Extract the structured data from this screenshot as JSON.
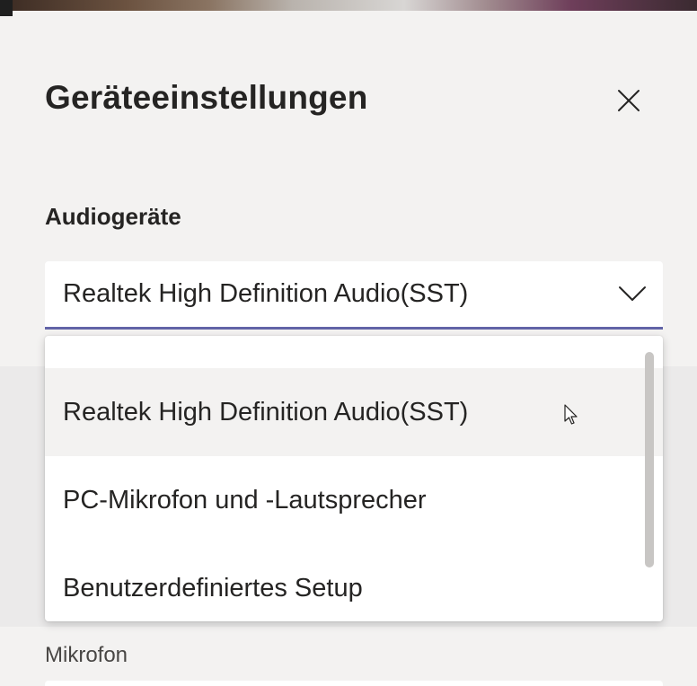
{
  "dialog": {
    "title": "Geräteeinstellungen",
    "close_icon": "close-icon"
  },
  "audio": {
    "label": "Audiogeräte",
    "selected": "Realtek High Definition Audio(SST)",
    "chevron_icon": "chevron-down-icon",
    "accent_color": "#6264a7",
    "options": [
      {
        "label": "Realtek High Definition Audio(SST)",
        "hovered": true
      },
      {
        "label": "PC-Mikrofon und -Lautsprecher",
        "hovered": false
      },
      {
        "label": "Benutzerdefiniertes Setup",
        "hovered": false
      }
    ]
  },
  "microphone": {
    "label": "Mikrofon"
  }
}
